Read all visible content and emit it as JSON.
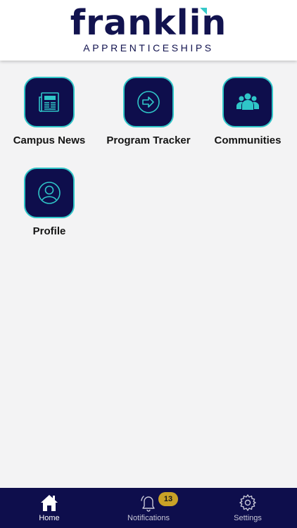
{
  "header": {
    "brand_name": "franklin",
    "brand_subtitle": "APPRENTICESHIPS"
  },
  "tiles": [
    {
      "label": "Campus News",
      "icon": "newspaper-icon"
    },
    {
      "label": "Program Tracker",
      "icon": "arrow-right-circle-icon"
    },
    {
      "label": "Communities",
      "icon": "people-group-icon"
    },
    {
      "label": "Profile",
      "icon": "user-circle-icon"
    }
  ],
  "tabbar": {
    "tabs": [
      {
        "label": "Home",
        "icon": "home-icon",
        "active": true
      },
      {
        "label": "Notifications",
        "icon": "bell-icon",
        "badge": "13"
      },
      {
        "label": "Settings",
        "icon": "gear-icon"
      }
    ]
  },
  "colors": {
    "brand_navy": "#0e0e4c",
    "accent_teal": "#2fc6c8",
    "badge_gold": "#c9a227",
    "background": "#f3f3f4"
  }
}
